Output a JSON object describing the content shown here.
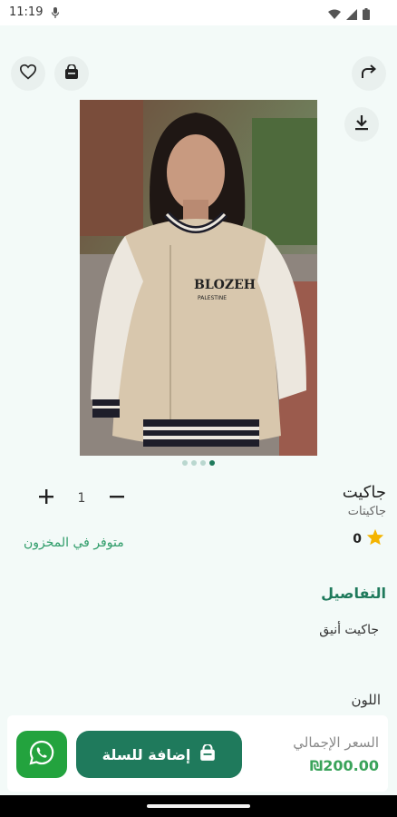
{
  "status_bar": {
    "time": "11:19",
    "icons": [
      "mic-icon",
      "wifi-icon",
      "signal-icon",
      "battery-icon"
    ]
  },
  "header": {
    "actions": [
      "favorite-heart-icon",
      "cart-bag-icon",
      "share-icon",
      "download-icon"
    ]
  },
  "gallery": {
    "image_alt": "Woman wearing a beige varsity jacket with BLOZEH PALESTINE print",
    "image_print_text": "BLOZEH",
    "image_print_sub": "PALESTINE",
    "pages": 4,
    "active_page_index": 3
  },
  "product": {
    "name": "جاكيت",
    "category": "جاكيتات",
    "rating": "0",
    "quantity": "1",
    "stock_status": "متوفر في المخزون",
    "details_title": "التفاصيل",
    "details_text": "جاكيت أنيق",
    "color_title": "اللون"
  },
  "bottom_bar": {
    "total_label": "السعر الإجمالي",
    "total_value": "₪200.00",
    "add_to_cart_label": "إضافة للسلة"
  },
  "colors": {
    "primary": "#1f7a5c",
    "accent_green": "#2e9c69",
    "whatsapp": "#23a33e",
    "star": "#f4b400",
    "background": "#f3faf8"
  }
}
